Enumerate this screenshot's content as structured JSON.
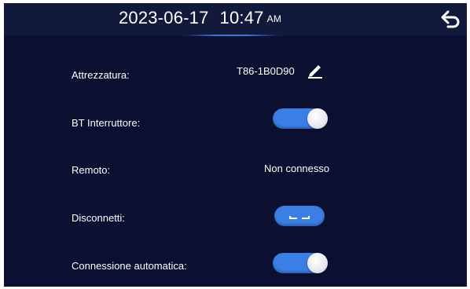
{
  "header": {
    "date": "2023-06-17",
    "time": "10:47",
    "ampm": "AM"
  },
  "settings": {
    "equipment": {
      "label": "Attrezzatura:",
      "value": "T86-1B0D90"
    },
    "bt_switch": {
      "label": "BT Interruttore:",
      "state": "on"
    },
    "remote": {
      "label": "Remoto:",
      "value": "Non connesso"
    },
    "disconnect": {
      "label": "Disconnetti:"
    },
    "auto_connect": {
      "label": "Connessione automatica:",
      "state": "on"
    }
  },
  "icons": {
    "back": "back-arrow-icon",
    "edit": "pencil-icon",
    "disconnect": "link-break-icon"
  },
  "colors": {
    "background": "#0b1030",
    "header": "#111a3a",
    "accent": "#3a7ee6"
  }
}
